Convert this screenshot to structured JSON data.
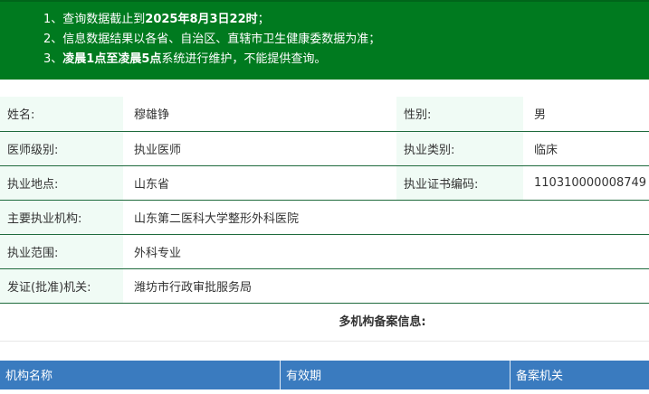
{
  "notice": {
    "line1_prefix": "1、查询数据截止到",
    "line1_bold": "2025年8月3日22时",
    "line1_suffix": "；",
    "line2": "2、信息数据结果以各省、自治区、直辖市卫生健康委数据为准；",
    "line3_prefix": "3、",
    "line3_bold": "凌晨1点至凌晨5点",
    "line3_suffix": "系统进行维护，不能提供查询。"
  },
  "info": {
    "name_label": "姓名:",
    "name": "穆雄铮",
    "gender_label": "性别:",
    "gender": "男",
    "level_label": "医师级别:",
    "level": "执业医师",
    "category_label": "执业类别:",
    "category": "临床",
    "location_label": "执业地点:",
    "location": "山东省",
    "cert_label": "执业证书编码:",
    "cert": "110310000008749",
    "org_label": "主要执业机构:",
    "org": "山东第二医科大学整形外科医院",
    "scope_label": "执业范围:",
    "scope": "外科专业",
    "authority_label": "发证(批准)机关:",
    "authority": "潍坊市行政审批服务局"
  },
  "multi_title": "多机构备案信息:",
  "table_headers": [
    "机构名称",
    "有效期",
    "备案机关"
  ]
}
